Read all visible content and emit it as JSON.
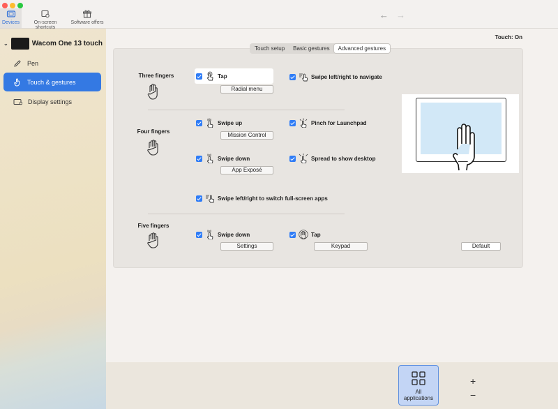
{
  "toolbar": {
    "devices": "Devices",
    "shortcuts": "On-screen shortcuts",
    "offers": "Software offers"
  },
  "sidebar": {
    "device_name": "Wacom One 13 touch",
    "items": [
      {
        "label": "Pen",
        "icon": "pen-icon"
      },
      {
        "label": "Touch & gestures",
        "icon": "touch-icon"
      },
      {
        "label": "Display settings",
        "icon": "display-icon"
      }
    ]
  },
  "touch_status": "Touch: On",
  "tabs": [
    "Touch setup",
    "Basic gestures",
    "Advanced gestures"
  ],
  "selected_tab": "Advanced gestures",
  "rows": {
    "three": "Three fingers",
    "four": "Four fingers",
    "five": "Five fingers"
  },
  "gestures": {
    "three_tap": {
      "label": "Tap",
      "checked": true,
      "action": "Radial menu"
    },
    "three_swipe": {
      "label": "Swipe left/right to navigate",
      "checked": true
    },
    "four_up": {
      "label": "Swipe up",
      "checked": true,
      "action": "Mission Control"
    },
    "four_pinch": {
      "label": "Pinch for Launchpad",
      "checked": true
    },
    "four_down": {
      "label": "Swipe down",
      "checked": true,
      "action": "App Exposé"
    },
    "four_spread": {
      "label": "Spread to show desktop",
      "checked": true
    },
    "four_lr": {
      "label": "Swipe left/right to switch full-screen apps",
      "checked": true
    },
    "five_down": {
      "label": "Swipe down",
      "checked": true,
      "action": "Settings"
    },
    "five_tap": {
      "label": "Tap",
      "checked": true,
      "action": "Keypad"
    }
  },
  "default_button": "Default",
  "bottom": {
    "all_apps_line1": "All",
    "all_apps_line2": "applications",
    "add": "+",
    "remove": "−"
  },
  "colors": {
    "accent": "#3479e3",
    "checkbox": "#2f7cf6",
    "preview_screen": "#d2e8f7"
  }
}
